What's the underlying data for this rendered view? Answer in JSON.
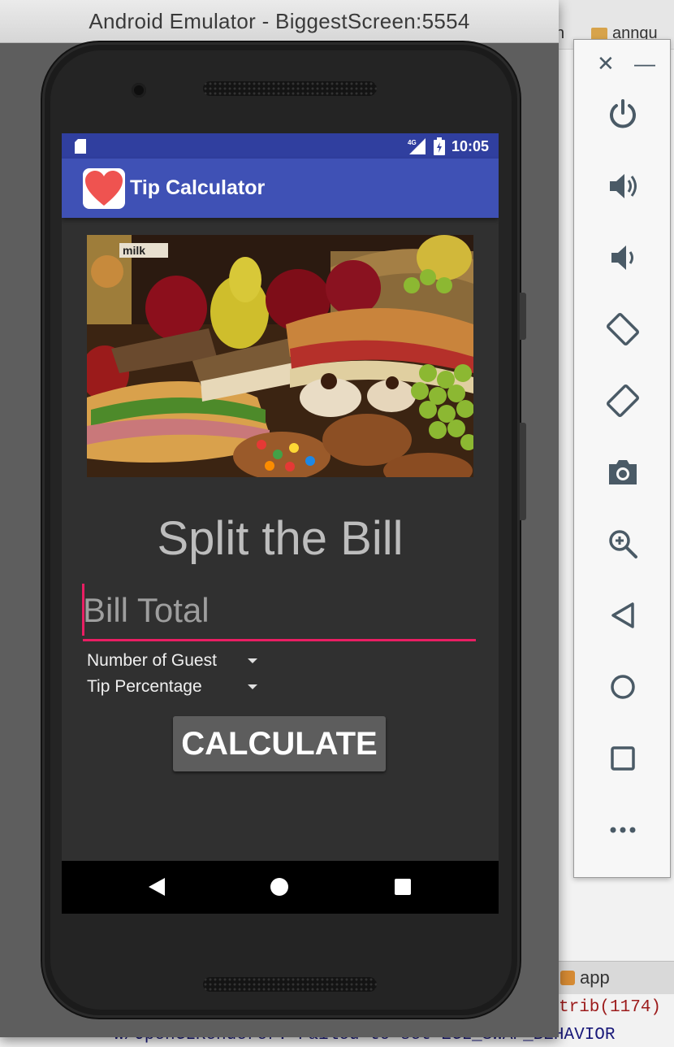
{
  "ide": {
    "tab_partial": "n",
    "tab_file": "anngu",
    "bottom_tab": "app",
    "log_line_1": "trib(1174)",
    "log_line_2": "W/OpenGLRenderer: Failed to set EGL_SWAP_BEHAVIOR"
  },
  "emulator": {
    "window_title": "Android Emulator - BiggestScreen:5554"
  },
  "status_bar": {
    "network": "4G",
    "time": "10:05"
  },
  "app_bar": {
    "title": "Tip Calculator"
  },
  "main": {
    "heading": "Split the Bill",
    "bill_input": {
      "placeholder": "Bill Total",
      "value": ""
    },
    "guests_spinner": {
      "label": "Number of Guest"
    },
    "tip_spinner": {
      "label": "Tip Percentage"
    },
    "calculate_button": "CALCULATE"
  },
  "toolbar": {
    "items": [
      "power-icon",
      "volume-up-icon",
      "volume-down-icon",
      "rotate-left-icon",
      "rotate-right-icon",
      "camera-icon",
      "zoom-icon",
      "back-icon",
      "home-icon",
      "overview-icon",
      "more-icon"
    ]
  },
  "colors": {
    "status_bar": "#303f9f",
    "app_bar": "#3f51b5",
    "accent": "#e91e63",
    "background": "#303030"
  }
}
